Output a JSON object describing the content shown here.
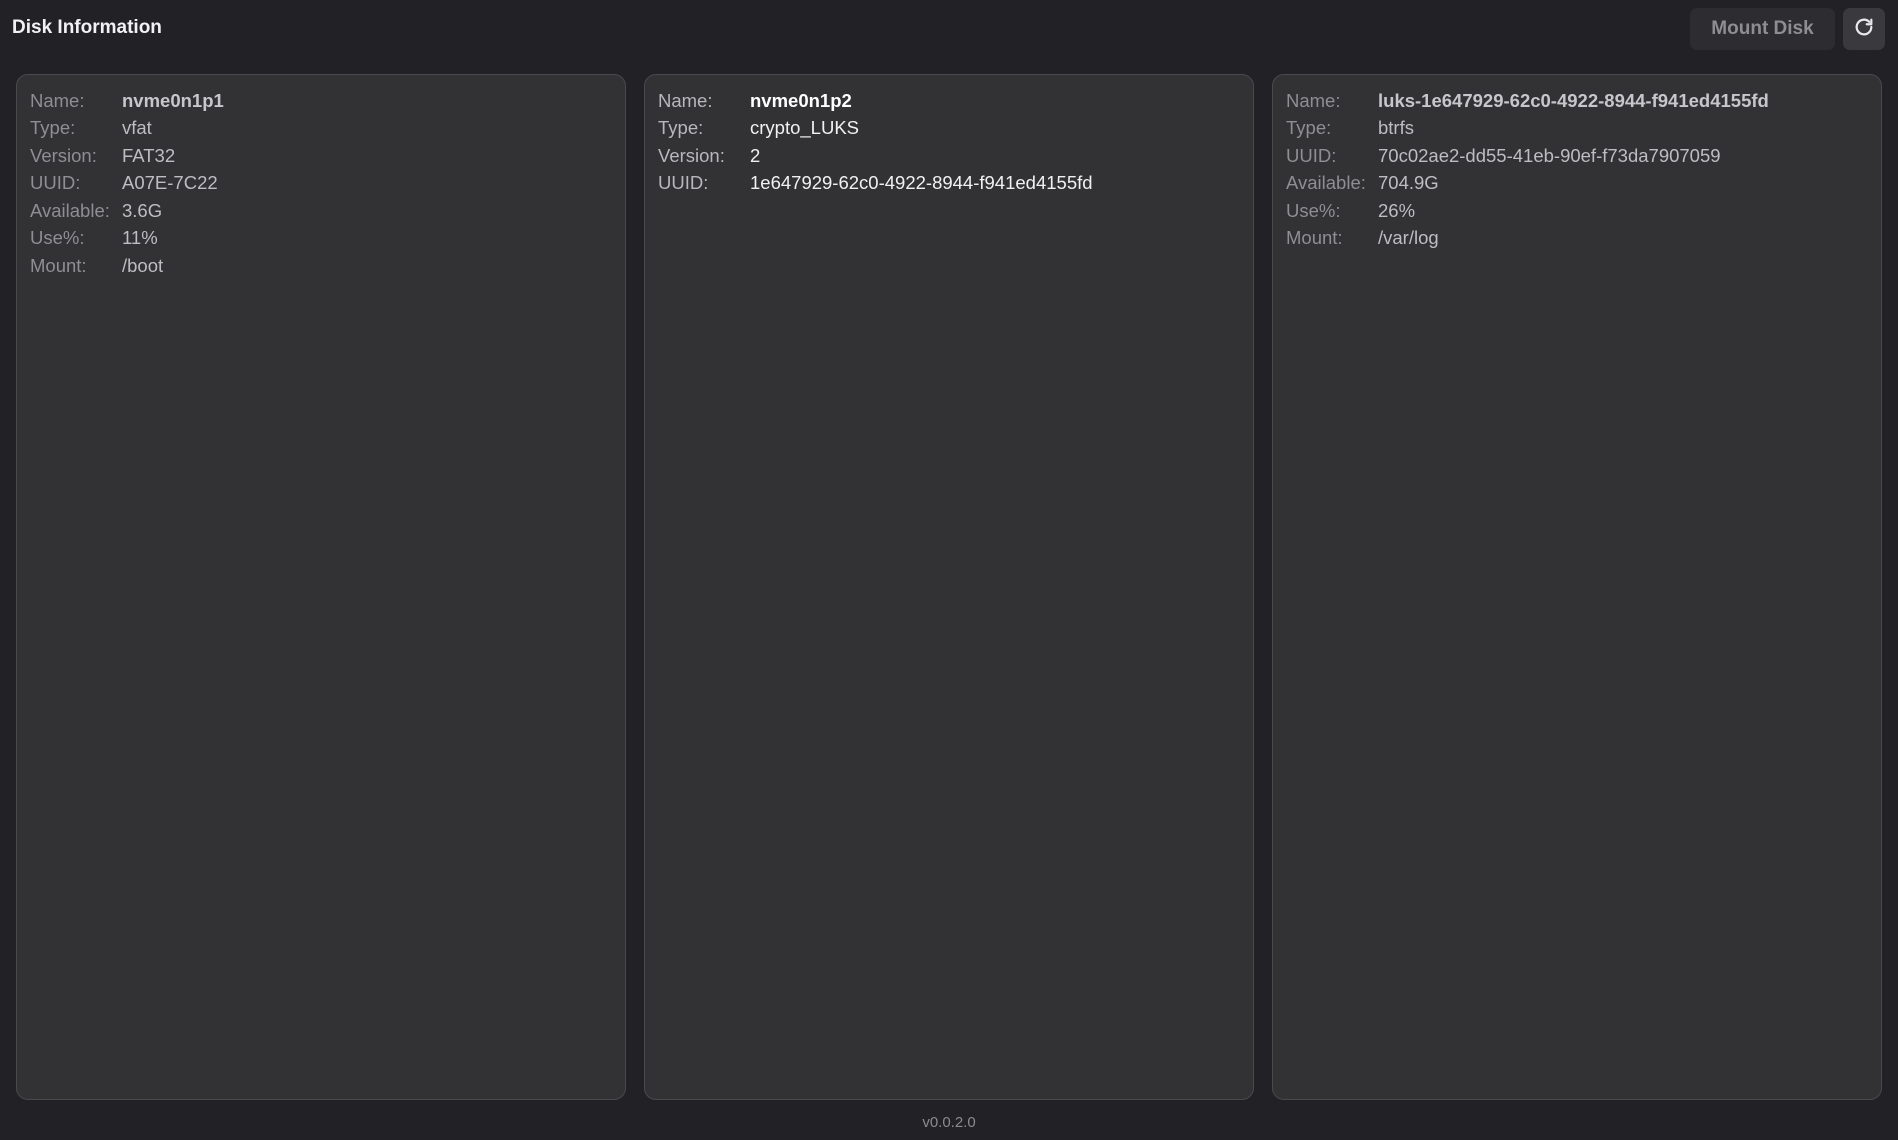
{
  "header": {
    "title": "Disk Information",
    "mount_label": "Mount Disk",
    "refresh_icon": "refresh-icon"
  },
  "disks": [
    {
      "name_label": "Name:",
      "name": "nvme0n1p1",
      "type_label": "Type:",
      "type": "vfat",
      "version_label": "Version:",
      "version": "FAT32",
      "uuid_label": "UUID:",
      "uuid": "A07E-7C22",
      "available_label": "Available:",
      "available": "3.6G",
      "use_label": "Use%:",
      "use": "11%",
      "mount_label": "Mount:",
      "mount": "/boot"
    },
    {
      "name_label": "Name:",
      "name": "nvme0n1p2",
      "type_label": "Type:",
      "type": "crypto_LUKS",
      "version_label": "Version:",
      "version": "2",
      "uuid_label": "UUID:",
      "uuid": "1e647929-62c0-4922-8944-f941ed4155fd"
    },
    {
      "name_label": "Name:",
      "name": "luks-1e647929-62c0-4922-8944-f941ed4155fd",
      "type_label": "Type:",
      "type": "btrfs",
      "uuid_label": "UUID:",
      "uuid": "70c02ae2-dd55-41eb-90ef-f73da7907059",
      "available_label": "Available:",
      "available": "704.9G",
      "use_label": "Use%:",
      "use": "26%",
      "mount_label": "Mount:",
      "mount": "/var/log"
    }
  ],
  "footer": {
    "version": "v0.0.2.0"
  },
  "colors": {
    "background": "#222226",
    "card": "#323235",
    "card_border": "#4a4a4e"
  }
}
